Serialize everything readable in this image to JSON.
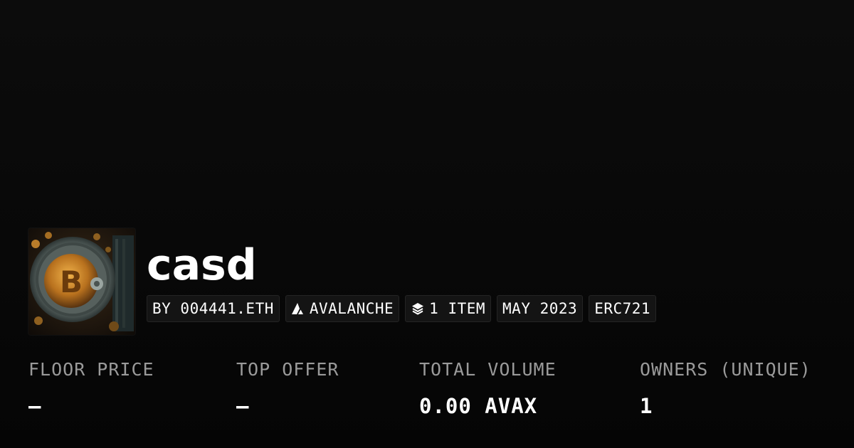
{
  "collection": {
    "name": "casd",
    "image_alt_icon": "bitcoin-vault-image",
    "tags": [
      {
        "icon": "",
        "label": "BY 004441.ETH"
      },
      {
        "icon": "avalanche-icon",
        "label": "AVALANCHE"
      },
      {
        "icon": "layers-icon",
        "label": "1 ITEM"
      },
      {
        "icon": "",
        "label": "MAY 2023"
      },
      {
        "icon": "",
        "label": "ERC721"
      }
    ]
  },
  "stats": [
    {
      "label": "FLOOR PRICE",
      "value": "—"
    },
    {
      "label": "TOP OFFER",
      "value": "—"
    },
    {
      "label": "TOTAL VOLUME",
      "value": "0.00 AVAX"
    },
    {
      "label": "OWNERS (UNIQUE)",
      "value": "1"
    }
  ],
  "colors": {
    "background": "#0a0a0a",
    "label": "#9a9a9a",
    "value": "#ffffff",
    "pill_bg": "#141414",
    "pill_border": "#242424"
  }
}
